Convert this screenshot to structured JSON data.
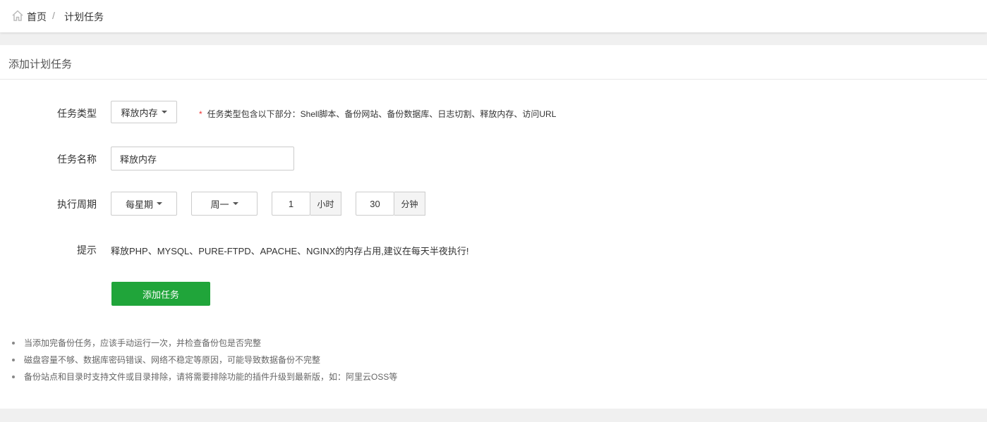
{
  "breadcrumb": {
    "home": "首页",
    "separator": "/",
    "current": "计划任务"
  },
  "panel": {
    "title": "添加计划任务"
  },
  "form": {
    "task_type": {
      "label": "任务类型",
      "value": "释放内存",
      "hint_star": "*",
      "hint": "任务类型包含以下部分：Shell脚本、备份网站、备份数据库、日志切割、释放内存、访问URL"
    },
    "task_name": {
      "label": "任务名称",
      "value": "释放内存"
    },
    "schedule": {
      "label": "执行周期",
      "period": "每星期",
      "weekday": "周一",
      "hour": "1",
      "hour_unit": "小时",
      "minute": "30",
      "minute_unit": "分钟"
    },
    "tip": {
      "label": "提示",
      "text": "释放PHP、MYSQL、PURE-FTPD、APACHE、NGINX的内存占用,建议在每天半夜执行!"
    },
    "submit_label": "添加任务"
  },
  "notes": [
    "当添加完备份任务，应该手动运行一次，并检查备份包是否完整",
    "磁盘容量不够、数据库密码错误、网络不稳定等原因，可能导致数据备份不完整",
    "备份站点和目录时支持文件或目录排除，请将需要排除功能的插件升级到最新版，如：阿里云OSS等"
  ],
  "colors": {
    "accent": "#20a53a",
    "required_star": "#ee3333"
  },
  "icons": {
    "home": "home-icon",
    "dropdown": "chevron-down-icon"
  }
}
